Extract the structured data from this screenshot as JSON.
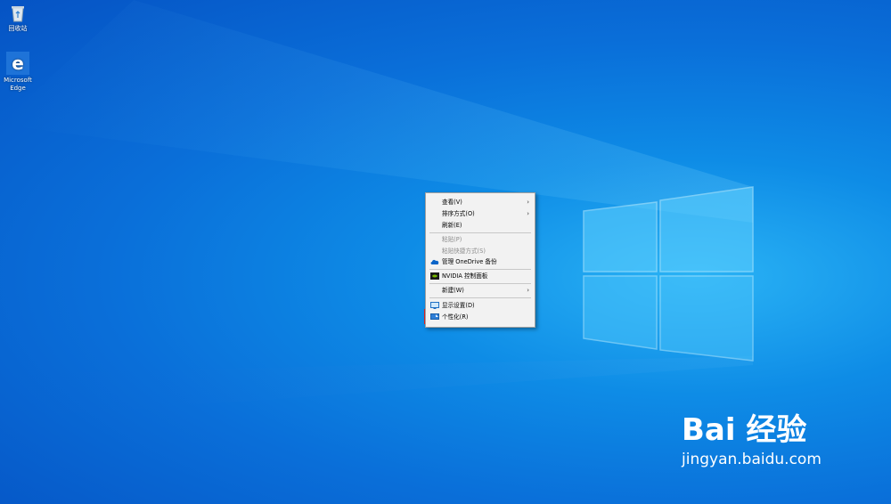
{
  "desktop": {
    "icons": [
      {
        "label": "回收站",
        "icon": "recycle-bin-icon"
      },
      {
        "label": "Microsoft\nEdge",
        "icon": "edge-icon"
      }
    ]
  },
  "context_menu": {
    "items": [
      {
        "label": "查看(V)",
        "submenu": true
      },
      {
        "label": "排序方式(O)",
        "submenu": true
      },
      {
        "label": "刷新(E)"
      },
      {
        "label": "粘贴(P)",
        "disabled": true
      },
      {
        "label": "粘贴快捷方式(S)",
        "disabled": true
      },
      {
        "label": "管理 OneDrive 备份",
        "icon": "onedrive-icon"
      },
      {
        "label": "NVIDIA 控制面板",
        "icon": "nvidia-icon"
      },
      {
        "label": "新建(W)",
        "submenu": true
      },
      {
        "label": "显示设置(D)",
        "icon": "display-icon"
      },
      {
        "label": "个性化(R)",
        "icon": "personalize-icon",
        "highlighted": true
      }
    ],
    "arrow_glyph": "›"
  },
  "watermark": {
    "brand": "Bai 经验",
    "url": "jingyan.baidu.com"
  },
  "colors": {
    "highlight_border": "#e3231f",
    "desktop_blue": "#0a6fd9"
  }
}
